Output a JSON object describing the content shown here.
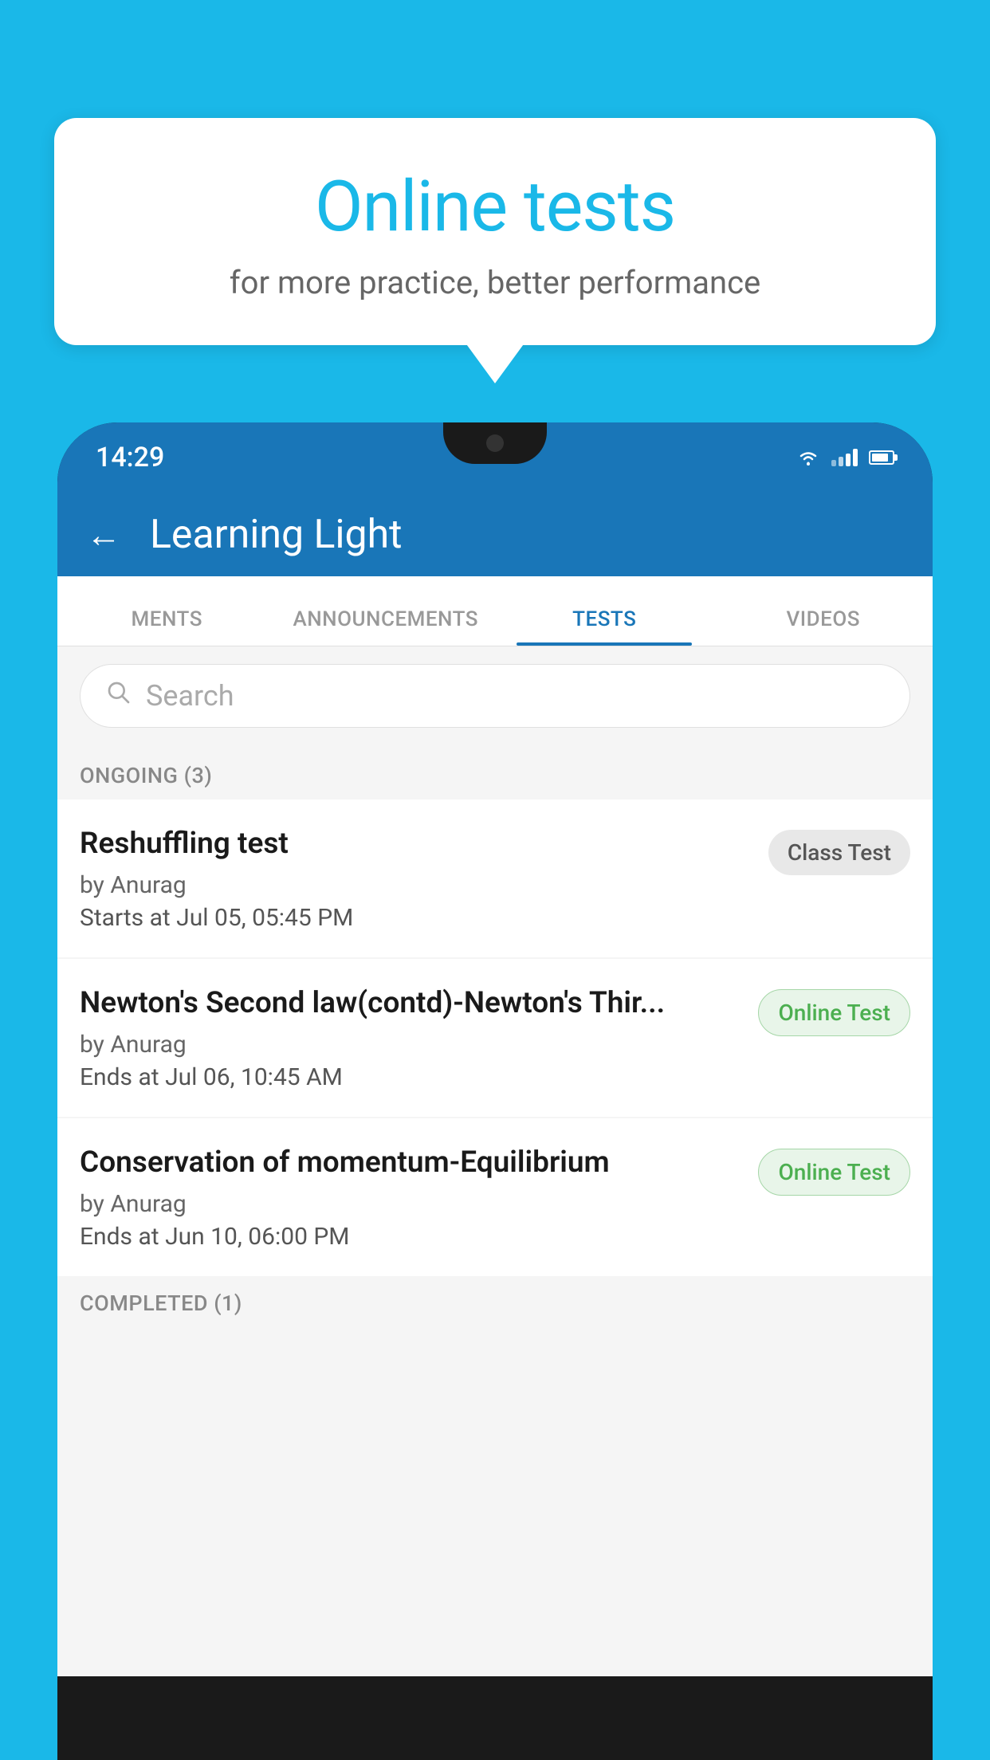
{
  "background_color": "#1ab8e8",
  "speech_bubble": {
    "title": "Online tests",
    "subtitle": "for more practice, better performance"
  },
  "phone": {
    "status_bar": {
      "time": "14:29"
    },
    "app_header": {
      "title": "Learning Light",
      "back_label": "←"
    },
    "tabs": [
      {
        "label": "MENTS",
        "active": false
      },
      {
        "label": "ANNOUNCEMENTS",
        "active": false
      },
      {
        "label": "TESTS",
        "active": true
      },
      {
        "label": "VIDEOS",
        "active": false
      }
    ],
    "search": {
      "placeholder": "Search"
    },
    "ongoing_section": {
      "header": "ONGOING (3)",
      "items": [
        {
          "name": "Reshuffling test",
          "by": "by Anurag",
          "time_label": "Starts at",
          "time": "Jul 05, 05:45 PM",
          "badge": "Class Test",
          "badge_type": "class"
        },
        {
          "name": "Newton's Second law(contd)-Newton's Thir...",
          "by": "by Anurag",
          "time_label": "Ends at",
          "time": "Jul 06, 10:45 AM",
          "badge": "Online Test",
          "badge_type": "online"
        },
        {
          "name": "Conservation of momentum-Equilibrium",
          "by": "by Anurag",
          "time_label": "Ends at",
          "time": "Jun 10, 06:00 PM",
          "badge": "Online Test",
          "badge_type": "online"
        }
      ]
    },
    "completed_section": {
      "header": "COMPLETED (1)"
    }
  }
}
